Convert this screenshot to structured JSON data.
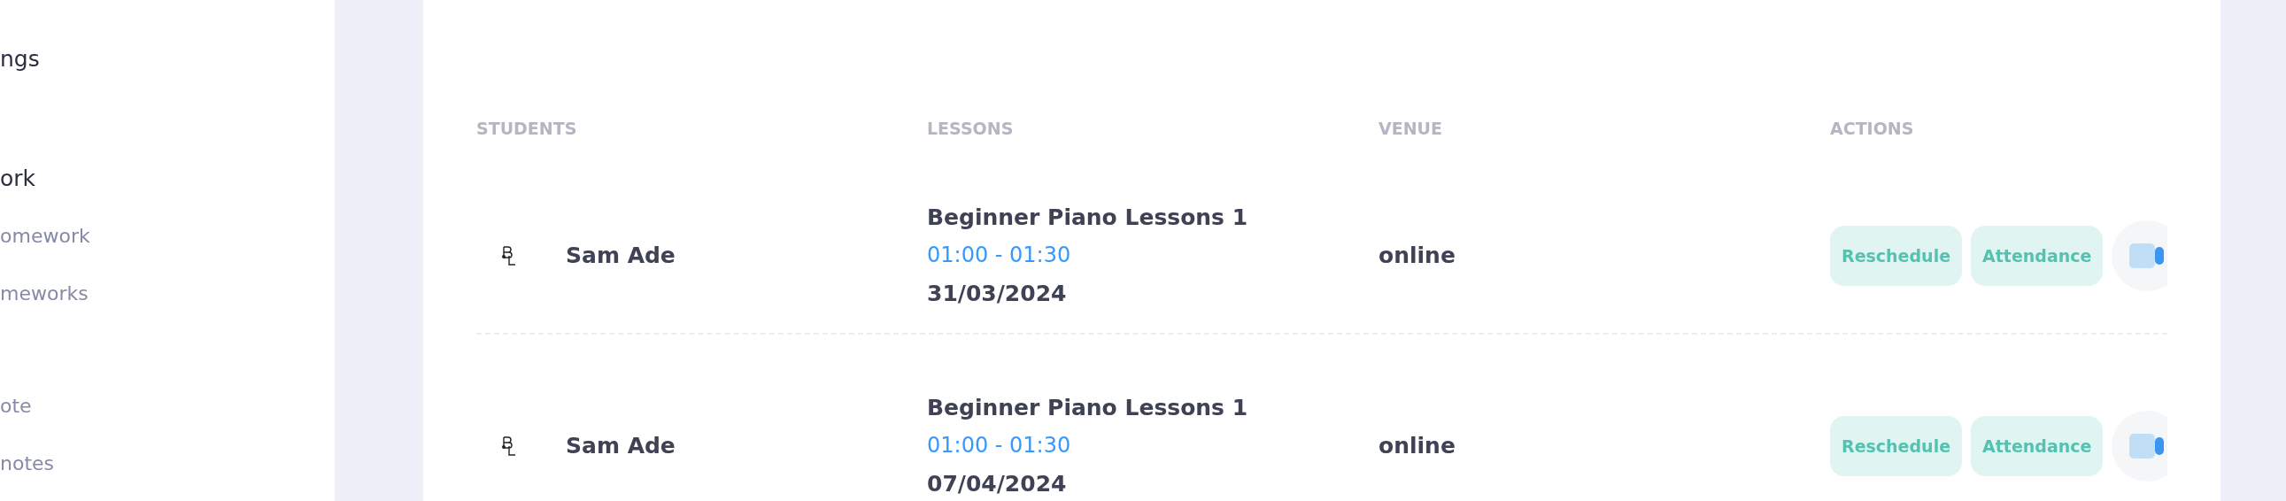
{
  "sidebar": {
    "items": [
      {
        "kind": "heading",
        "label": "ngs"
      },
      {
        "kind": "heading",
        "label": "ork"
      },
      {
        "kind": "link",
        "label": "omework"
      },
      {
        "kind": "link",
        "label": "meworks"
      },
      {
        "kind": "link",
        "label": "ote"
      },
      {
        "kind": "link",
        "label": "notes"
      }
    ]
  },
  "table": {
    "columns": [
      "STUDENTS",
      "LESSONS",
      "VENUE",
      "ACTIONS"
    ],
    "rows": [
      {
        "student": "Sam Ade",
        "lesson": "Beginner Piano Lessons 1",
        "time": "01:00 - 01:30",
        "date": "31/03/2024",
        "venue": "online",
        "actions": [
          "Reschedule",
          "Attendance"
        ]
      },
      {
        "student": "Sam Ade",
        "lesson": "Beginner Piano Lessons 1",
        "time": "01:00 - 01:30",
        "date": "07/04/2024",
        "venue": "online",
        "actions": [
          "Reschedule",
          "Attendance"
        ]
      }
    ]
  }
}
